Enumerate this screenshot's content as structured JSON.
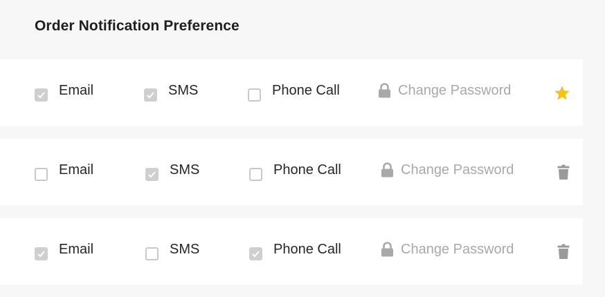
{
  "title": "Order Notification Preference",
  "rows": [
    {
      "options": [
        {
          "label": "Email",
          "checked": true
        },
        {
          "label": "SMS",
          "checked": true
        },
        {
          "label": "Phone Call",
          "checked": false
        }
      ],
      "password_label": "Change Password",
      "action_icon": "star-icon"
    },
    {
      "options": [
        {
          "label": "Email",
          "checked": false
        },
        {
          "label": "SMS",
          "checked": true
        },
        {
          "label": "Phone Call",
          "checked": false
        }
      ],
      "password_label": "Change Password",
      "action_icon": "trash-icon"
    },
    {
      "options": [
        {
          "label": "Email",
          "checked": true
        },
        {
          "label": "SMS",
          "checked": false
        },
        {
          "label": "Phone Call",
          "checked": true
        }
      ],
      "password_label": "Change Password",
      "action_icon": "trash-icon"
    }
  ],
  "colors": {
    "star": "#f2c318",
    "trash": "#9a9a9a",
    "lock": "#a9a9a9",
    "checked_box": "#cfcfcf"
  }
}
